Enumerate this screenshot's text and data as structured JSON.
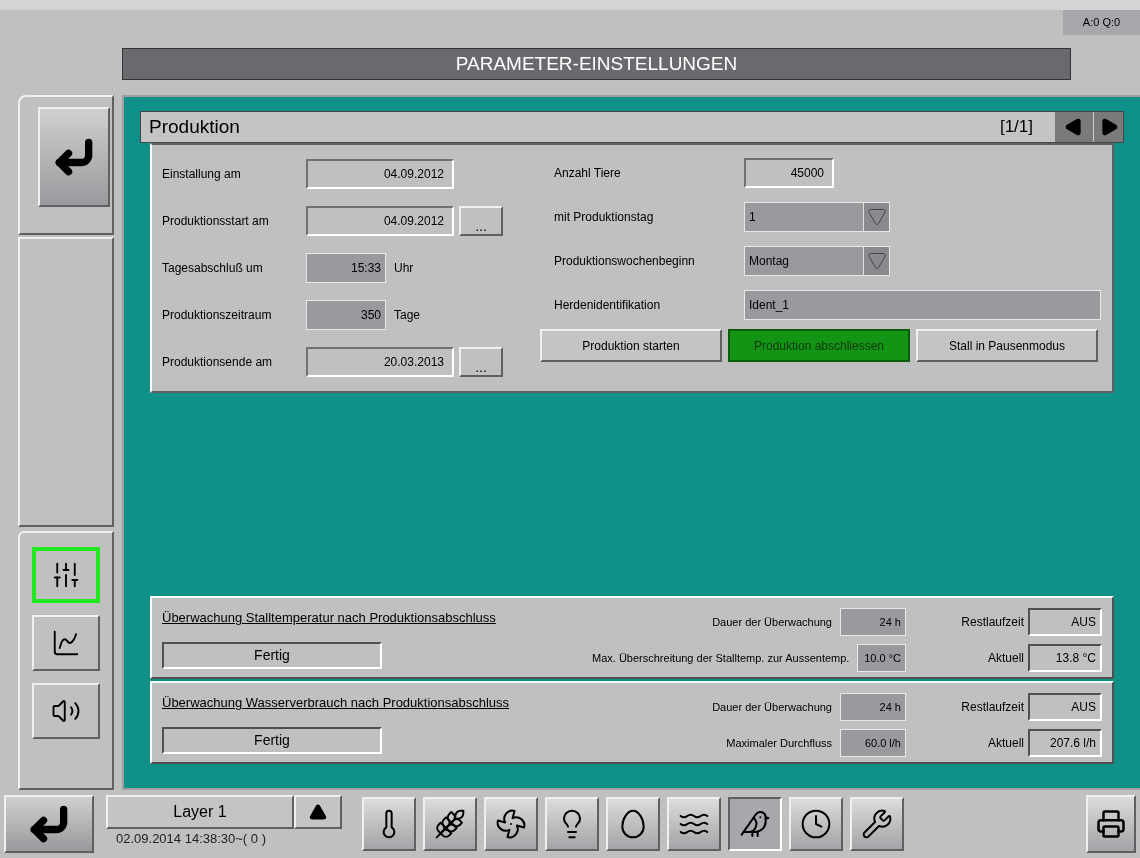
{
  "status": "A:0 Q:0",
  "title": "PARAMETER-EINSTELLUNGEN",
  "side_tabs": [
    {
      "kind": "sliders",
      "selected": true
    },
    {
      "kind": "chart",
      "selected": false
    },
    {
      "kind": "speaker",
      "selected": false
    }
  ],
  "panel": {
    "title": "Produktion",
    "page": "[1/1]"
  },
  "fields_left": [
    {
      "label": "Einstallung am",
      "value": "04.09.2012",
      "kind": "output"
    },
    {
      "label": "Produktionsstart am",
      "value": "04.09.2012",
      "kind": "output",
      "button": "..."
    },
    {
      "label": "Tagesabschluß um",
      "value": "15:33",
      "kind": "input",
      "unit": "Uhr"
    },
    {
      "label": "Produktionszeitraum",
      "value": "350",
      "kind": "input",
      "unit": "Tage"
    },
    {
      "label": "Produktionsende am",
      "value": "20.03.2013",
      "kind": "output",
      "button": "..."
    }
  ],
  "fields_right": [
    {
      "label": "Anzahl Tiere",
      "value": "45000",
      "kind": "output"
    },
    {
      "label": "mit Produktionstag",
      "value": "1",
      "kind": "dropdown"
    },
    {
      "label": "Produktionswochenbeginn",
      "value": "Montag",
      "kind": "dropdown"
    },
    {
      "label": "Herdenidentifikation",
      "value": "Ident_1",
      "kind": "input"
    }
  ],
  "actions": [
    {
      "label": "Produktion starten",
      "active": false
    },
    {
      "label": "Produktion abschliessen",
      "active": true
    },
    {
      "label": "Stall in Pausenmodus",
      "active": false
    }
  ],
  "monitors": [
    {
      "title": "Überwachung Stalltemperatur nach Produktionsabschluss",
      "status": "Fertig",
      "settings": [
        {
          "label": "Dauer der Überwachung",
          "value": "24 h"
        },
        {
          "label": "Max. Überschreitung der Stalltemp. zur Aussentemp.",
          "value": "10.0 °C"
        }
      ],
      "readings": [
        {
          "label": "Restlaufzeit",
          "value": "AUS"
        },
        {
          "label": "Aktuell",
          "value": "13.8 °C"
        }
      ]
    },
    {
      "title": "Überwachung Wasserverbrauch nach Produktionsabschluss",
      "status": "Fertig",
      "settings": [
        {
          "label": "Dauer der Überwachung",
          "value": "24 h"
        },
        {
          "label": "Maximaler Durchfluss",
          "value": "60.0 l/h"
        }
      ],
      "readings": [
        {
          "label": "Restlaufzeit",
          "value": "AUS"
        },
        {
          "label": "Aktuell",
          "value": "207.6 l/h"
        }
      ]
    }
  ],
  "layer": {
    "name": "Layer 1",
    "datetime": "02.09.2014 14:38:30~( 0 )"
  },
  "tools": [
    {
      "kind": "thermometer",
      "selected": false
    },
    {
      "kind": "feeding",
      "selected": false
    },
    {
      "kind": "fan",
      "selected": false
    },
    {
      "kind": "light",
      "selected": false
    },
    {
      "kind": "egg",
      "selected": false
    },
    {
      "kind": "water",
      "selected": false
    },
    {
      "kind": "animals",
      "selected": true
    },
    {
      "kind": "clock",
      "selected": false
    },
    {
      "kind": "tools",
      "selected": false
    }
  ]
}
